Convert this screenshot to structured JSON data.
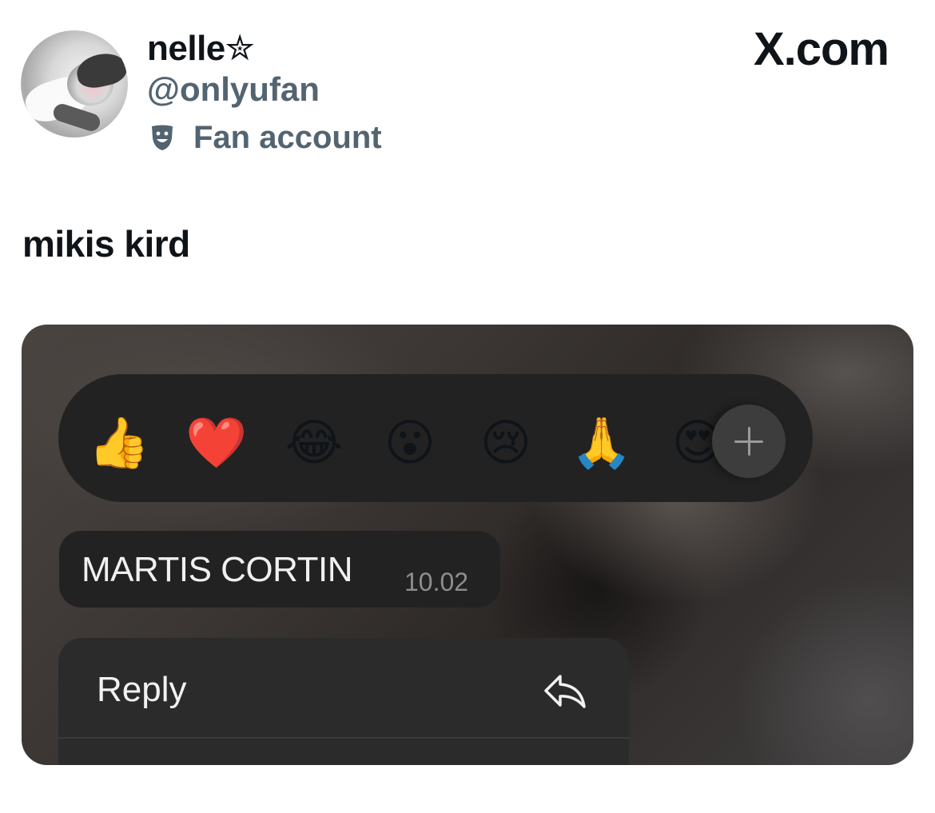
{
  "post": {
    "display_name": "nelle✮",
    "handle": "@onlyufan",
    "account_label": "Fan account",
    "label_icon": "theater-masks-icon",
    "brand": "X.com",
    "text": "mikis kird"
  },
  "media": {
    "reactions": [
      {
        "name": "thumbs-up-emoji",
        "glyph": "👍"
      },
      {
        "name": "red-heart-emoji",
        "glyph": "❤️"
      },
      {
        "name": "tears-of-joy-emoji",
        "glyph": "😂"
      },
      {
        "name": "surprised-face-emoji",
        "glyph": "😮"
      },
      {
        "name": "crying-face-emoji",
        "glyph": "😢"
      },
      {
        "name": "folded-hands-emoji",
        "glyph": "🙏"
      },
      {
        "name": "heart-eyes-emoji",
        "glyph": "😍"
      }
    ],
    "add_reaction_icon": "plus-icon",
    "message": {
      "text": "MARTIS CORTIN",
      "time": "10.02"
    },
    "menu": {
      "items": [
        {
          "label": "Reply",
          "icon": "reply-arrow-icon"
        }
      ]
    }
  },
  "colors": {
    "text_primary": "#0f1419",
    "text_secondary": "#536471",
    "bubble_bg": "#232222",
    "menu_bg": "#2c2b2b"
  }
}
